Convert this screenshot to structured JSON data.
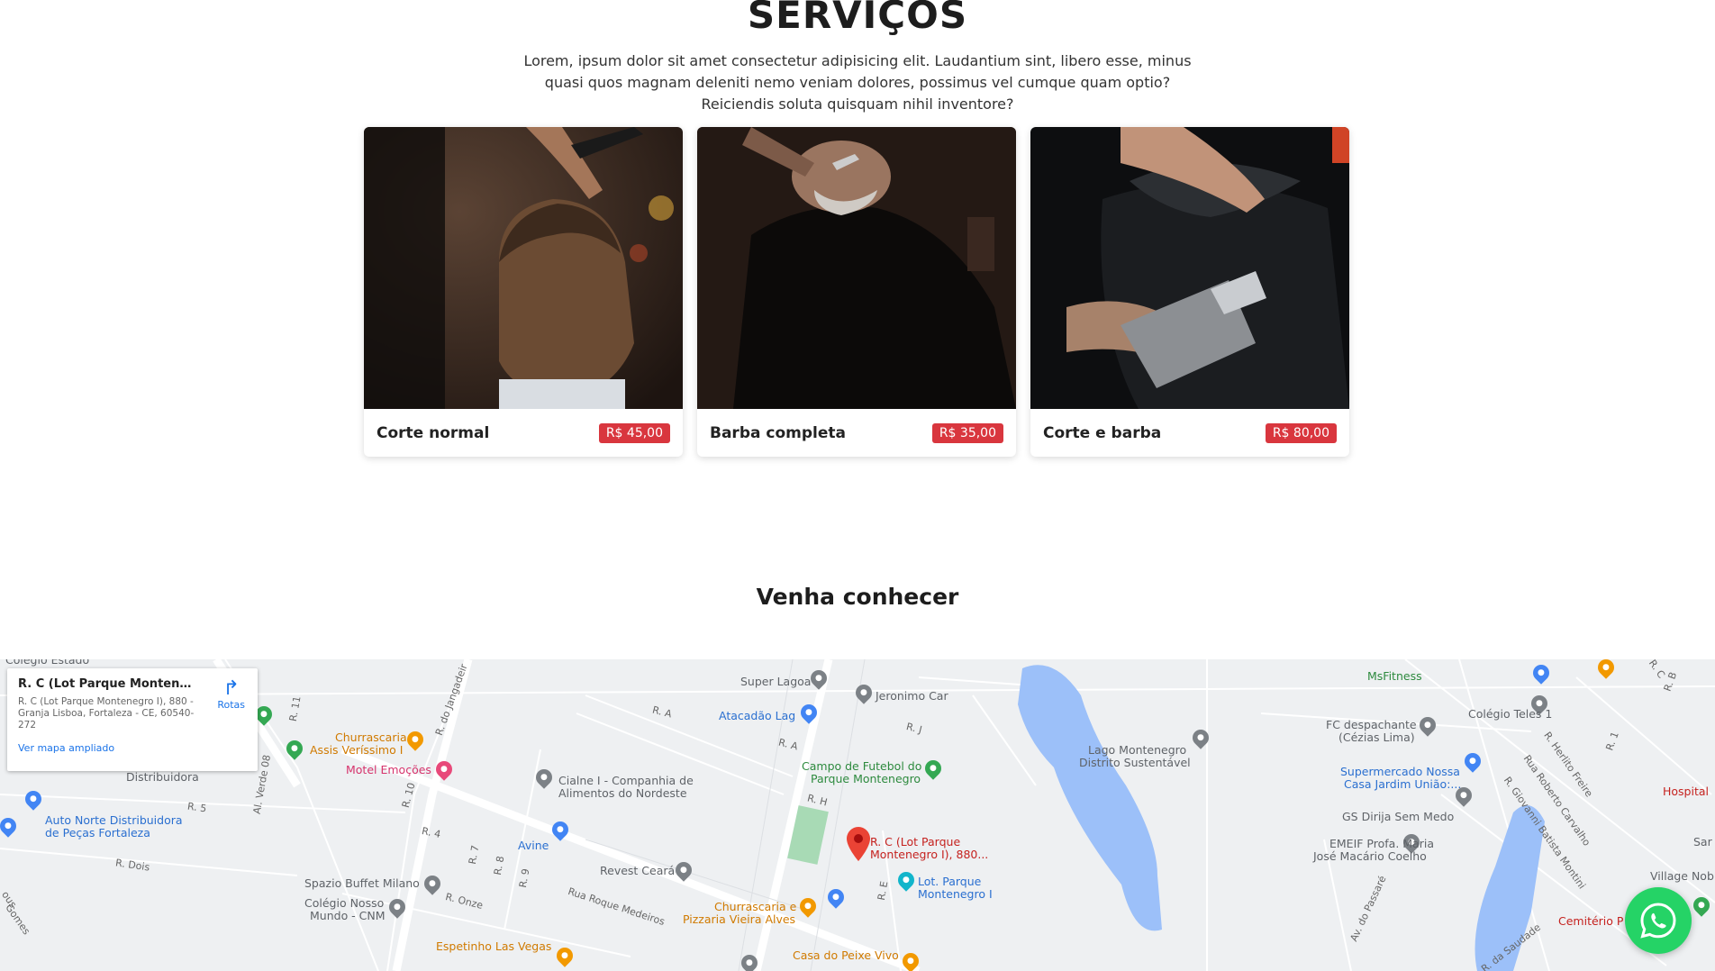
{
  "services": {
    "title": "SERVIÇOS",
    "description": "Lorem, ipsum dolor sit amet consectetur adipisicing elit. Laudantium sint, libero esse, minus quasi quos magnam deleniti nemo veniam dolores, possimus vel cumque quam optio? Reiciendis soluta quisquam nihil inventore?",
    "cards": [
      {
        "name": "Corte normal",
        "price": "R$ 45,00"
      },
      {
        "name": "Barba completa",
        "price": "R$ 35,00"
      },
      {
        "name": "Corte e barba",
        "price": "R$ 80,00"
      }
    ]
  },
  "visit": {
    "title": "Venha conhecer"
  },
  "map": {
    "info": {
      "title": "R. C (Lot Parque Montenegro I...",
      "address": "R. C (Lot Parque Montenegro I), 880 - Granja Lisboa, Fortaleza - CE, 60540-272",
      "link": "Ver mapa ampliado",
      "route": "Rotas"
    },
    "labels": {
      "colegio_estado": "Colégio Estado",
      "distribuidora": "Distribuidora",
      "auto_norte": "Auto Norte Distribuidora",
      "auto_norte2": "de Peças Fortaleza",
      "r_dois": "R. Dois",
      "r5": "R. 5",
      "r11": "R. 11",
      "r10": "R. 10",
      "r4": "R. 4",
      "r7": "R. 7",
      "r8": "R. 8",
      "r9": "R. 9",
      "al_verde": "Al. Verde 08",
      "r_jangadeiro": "R. do Jangadeir",
      "churrascaria_assis": "Churrascaria",
      "churrascaria_assis2": "Assis Veríssimo I",
      "motel": "Motel Emoções",
      "cialne": "Cialne I - Companhia de",
      "cialne2": "Alimentos do Nordeste",
      "avine": "Avine",
      "revest": "Revest Ceará",
      "spazio": "Spazio Buffet Milano",
      "colegio_nosso": "Colégio Nosso",
      "colegio_nosso2": "Mundo - CNM",
      "r_onze": "R. Onze",
      "rua_roque": "Rua Roque Medeiros",
      "espetinho": "Espetinho Las Vegas",
      "super_lagoa": "Super Lagoa",
      "jeronimo": "Jeronimo Car",
      "atacadao": "Atacadão Lag",
      "ra": "R. A",
      "ra2": "R. A",
      "rj": "R. J",
      "rh": "R. H",
      "re": "R. E",
      "campo": "Campo de Futebol do",
      "campo2": "Parque Montenegro",
      "rc_pin": "R. C (Lot Parque",
      "rc_pin2": "Montenegro I), 880...",
      "lot_parque": "Lot. Parque",
      "lot_parque2": "Montenegro I",
      "churrascaria_vieira": "Churrascaria e",
      "churrascaria_vieira2": "Pizzaria Vieira Alves",
      "casa_peixe": "Casa do Peixe Vivo",
      "lago": "Lago Montenegro",
      "lago2": "Distrito Sustentável",
      "msfitness": "MsFitness",
      "fc_desp": "FC despachante",
      "fc_desp2": "(Cézias Lima)",
      "colegio_teles": "Colégio Teles 1",
      "supermercado": "Supermercado Nossa",
      "supermercado2": "Casa Jardim União:...",
      "gs_dirija": "GS Dirija Sem Medo",
      "emeif": "EMEIF Profa. Maria",
      "emeif2": "José Macário Coelho",
      "hospital": "Hospital",
      "village": "Village Nob",
      "cemiterio": "Cemitério P",
      "sar": "Sar",
      "r_heriito": "R. Herlito Freire",
      "rua_roberto": "Rua Roberto Carvalho",
      "r_giovanni": "R. Giovanni Batista Montini",
      "av_passare": "Av. do Passaré",
      "r_saudade": "R. da Saudade",
      "r1": "R. 1",
      "rc_top": "R. C",
      "rb_top": "R. B",
      "gomes": "Gomes",
      "ous": "ous"
    }
  },
  "colors": {
    "price_badge": "#d9363e",
    "whatsapp": "#25d366",
    "map_water": "#9cc0f9",
    "map_background": "#eef0f2"
  },
  "icons": {
    "whatsapp": "whatsapp-icon",
    "route": "directions-icon",
    "pin": "location-pin-icon"
  }
}
